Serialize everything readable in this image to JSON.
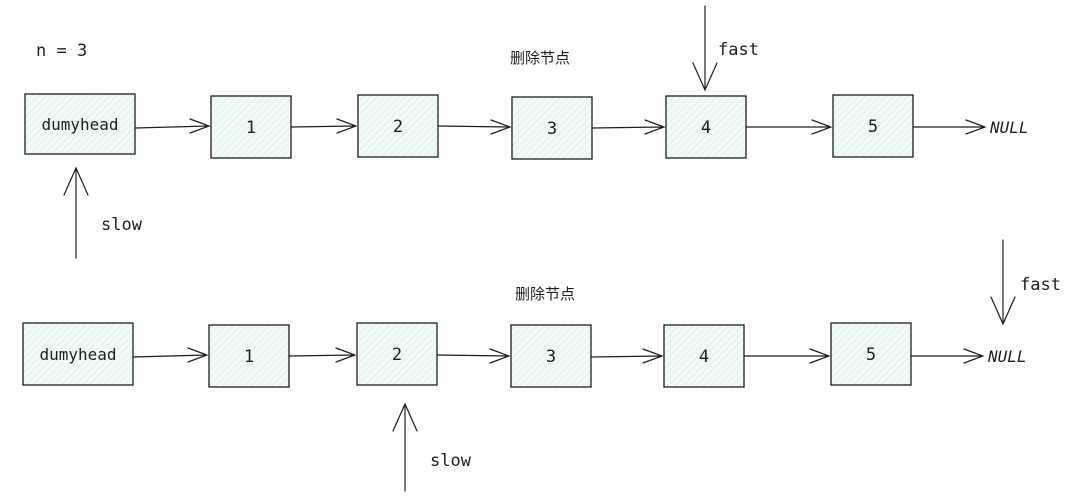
{
  "n_label": "n = 3",
  "rows": [
    {
      "caption": "删除节点",
      "nodes": [
        "dumyhead",
        "1",
        "2",
        "3",
        "4",
        "5"
      ],
      "terminal": "NULL",
      "fast": {
        "label": "fast",
        "target": "4"
      },
      "slow": {
        "label": "slow",
        "target": "dumyhead"
      }
    },
    {
      "caption": "删除节点",
      "nodes": [
        "dumyhead",
        "1",
        "2",
        "3",
        "4",
        "5"
      ],
      "terminal": "NULL",
      "fast": {
        "label": "fast",
        "target": "NULL"
      },
      "slow": {
        "label": "slow",
        "target": "2"
      }
    }
  ],
  "colors": {
    "stroke": "#1e1e1e",
    "fill": "#eef8f6",
    "hatch": "#bfe3dd"
  }
}
